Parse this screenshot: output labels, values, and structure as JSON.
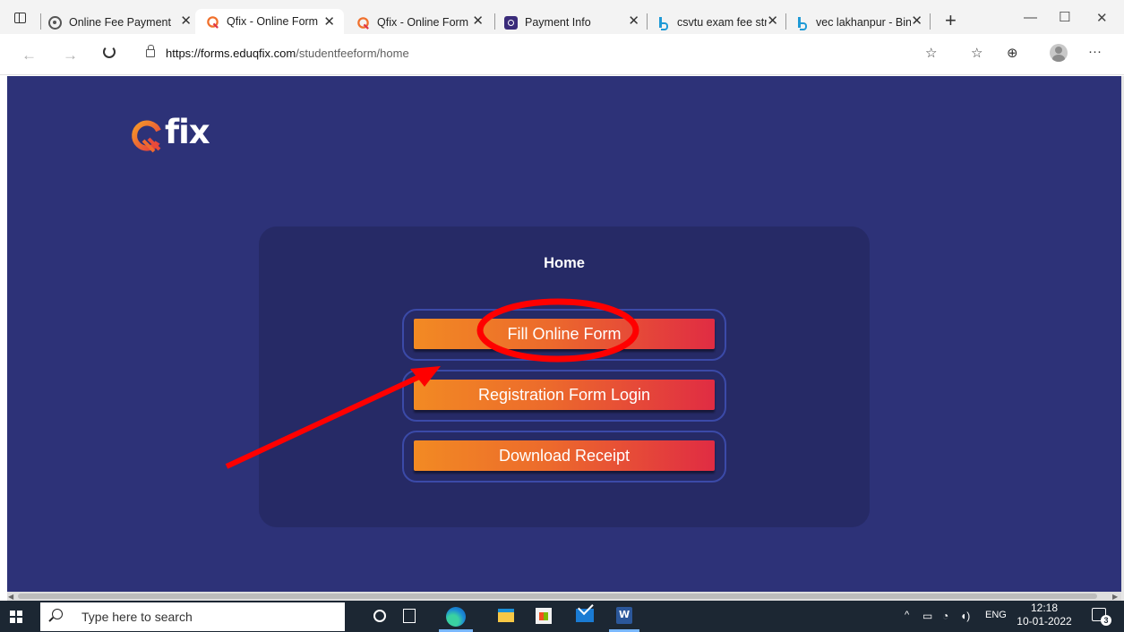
{
  "browser": {
    "tabs": [
      {
        "label": "Online Fee Payment",
        "icon": "gear-icon"
      },
      {
        "label": "Qfix - Online Form",
        "icon": "qfix-icon",
        "active": true
      },
      {
        "label": "Qfix - Online Form",
        "icon": "qfix-icon"
      },
      {
        "label": "Payment Info",
        "icon": "payment-icon"
      },
      {
        "label": "csvtu exam fee stru",
        "icon": "bing-icon"
      },
      {
        "label": "vec lakhanpur - Bin",
        "icon": "bing-icon"
      }
    ],
    "close_glyph": "✕",
    "new_tab_glyph": "+",
    "window_controls": {
      "minimize": "—",
      "maximize": "☐",
      "close": "✕"
    },
    "address": {
      "host": "https://forms.eduqfix.com",
      "path": "/studentfeeform/home"
    },
    "menu_glyph": "···"
  },
  "page": {
    "logo_text": "fix",
    "card_title": "Home",
    "buttons": {
      "fill_online_form": "Fill Online Form",
      "registration_login": "Registration Form Login",
      "download_receipt": "Download Receipt"
    },
    "colors": {
      "background": "#2d3278",
      "card": "#262a66",
      "button_start": "#f28a23",
      "button_end": "#e02c43",
      "annotation": "#ff0000"
    }
  },
  "taskbar": {
    "search_placeholder": "Type here to search",
    "language": "ENG",
    "time": "12:18",
    "date": "10-01-2022",
    "notification_count": "3"
  }
}
